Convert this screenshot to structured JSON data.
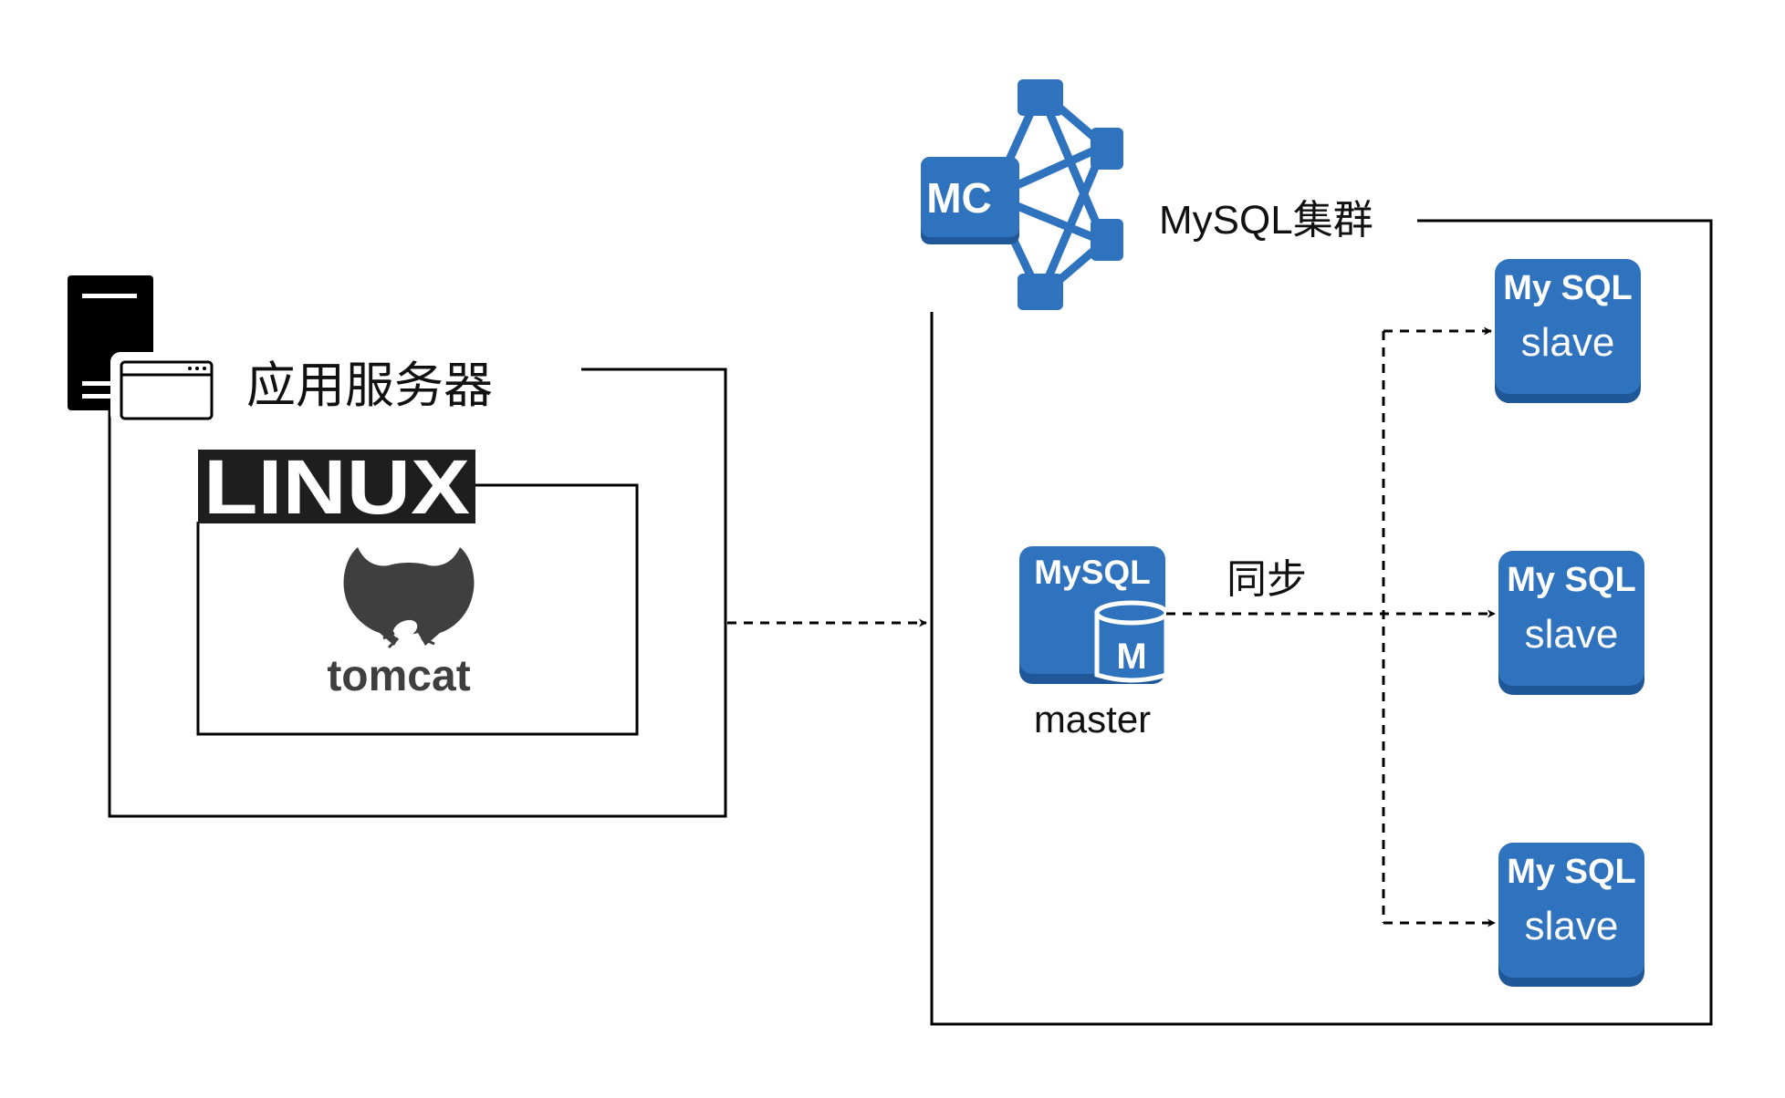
{
  "app_server": {
    "title": "应用服务器",
    "os_label": "LINUX",
    "webapp_label": "tomcat"
  },
  "mysql_cluster": {
    "title": "MySQL集群",
    "manager_badge": "MC",
    "master": {
      "brand": "MySQL",
      "badge": "M",
      "caption": "master"
    },
    "sync_label": "同步",
    "slaves": [
      {
        "brand": "My SQL",
        "role": "slave"
      },
      {
        "brand": "My SQL",
        "role": "slave"
      },
      {
        "brand": "My SQL",
        "role": "slave"
      }
    ]
  },
  "colors": {
    "mysql_blue": "#2f72bd",
    "mysql_blue_dark": "#1f5799",
    "line": "#000000",
    "tomcat_gray": "#3f3f3f",
    "linux_bg": "#1e1e1e"
  },
  "icons": {
    "server": "server-icon",
    "window": "browser-window-icon",
    "tomcat": "tomcat-cat-icon",
    "cluster_manager": "mysql-cluster-manager-icon",
    "database": "database-cylinder-icon"
  }
}
